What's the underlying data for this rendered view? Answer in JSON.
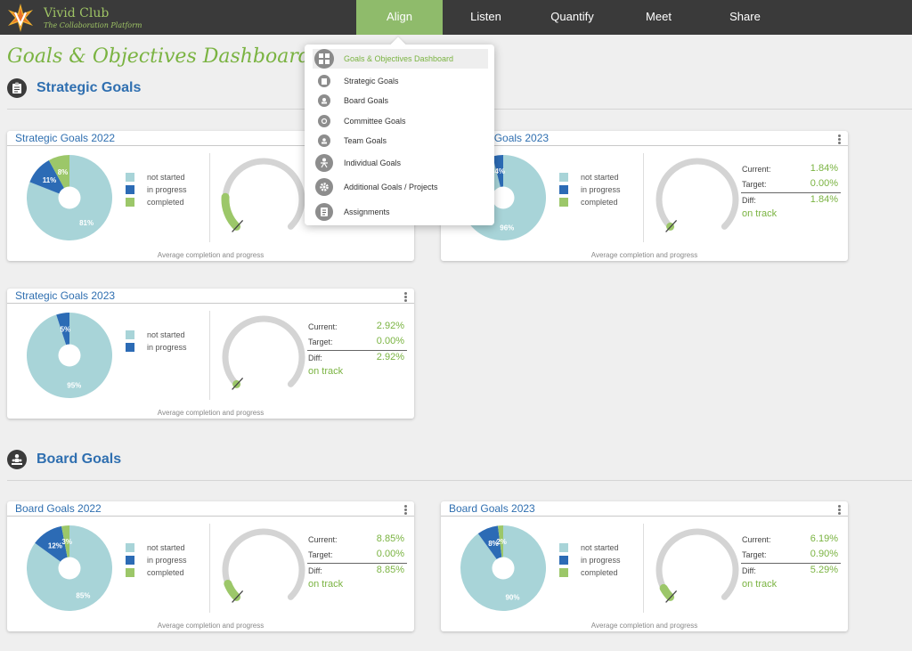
{
  "brand": {
    "name": "Vivid Club",
    "tagline": "The Collaboration Platform"
  },
  "nav": [
    "Align",
    "Listen",
    "Quantify",
    "Meet",
    "Share"
  ],
  "page_title": "Goals & Objectives Dashboard",
  "dropdown": [
    {
      "label": "Goals & Objectives Dashboard",
      "icon": "dashboard-icon",
      "active": true
    },
    {
      "label": "Strategic Goals",
      "icon": "strategic-goals-icon"
    },
    {
      "label": "Board Goals",
      "icon": "board-goals-icon"
    },
    {
      "label": "Committee Goals",
      "icon": "committee-goals-icon"
    },
    {
      "label": "Team Goals",
      "icon": "team-goals-icon"
    },
    {
      "label": "Individual Goals",
      "icon": "individual-goals-icon"
    },
    {
      "label": "Additional Goals / Projects",
      "icon": "gear-icon"
    },
    {
      "label": "Assignments",
      "icon": "assignments-icon"
    }
  ],
  "sections": {
    "strategic": {
      "title": "Strategic Goals"
    },
    "board": {
      "title": "Board Goals"
    }
  },
  "colors": {
    "not_started": "#a8d4d8",
    "in_progress": "#2c6bb5",
    "completed": "#9cc769",
    "accent_green": "#7ab341",
    "title_blue": "#2f6fb0"
  },
  "legend_labels": {
    "not_started": "not started",
    "in_progress": "in progress",
    "completed": "completed"
  },
  "caption": "Average completion and progress",
  "stat_labels": {
    "current": "Current:",
    "target": "Target:",
    "diff": "Diff:"
  },
  "cards": [
    {
      "id": "sg2022",
      "title": "Strategic Goals 2022",
      "slices": [
        {
          "key": "not_started",
          "value": 81,
          "label": "81%"
        },
        {
          "key": "in_progress",
          "value": 11,
          "label": "11%"
        },
        {
          "key": "completed",
          "value": 8,
          "label": "8%"
        }
      ],
      "gauge_progress": 0.18,
      "current": "",
      "target": "",
      "diff": "",
      "status": ""
    },
    {
      "id": "sg2023a",
      "title": "Strategic Goals 2023",
      "slices": [
        {
          "key": "not_started",
          "value": 96,
          "label": "96%"
        },
        {
          "key": "in_progress",
          "value": 4,
          "label": "4%"
        }
      ],
      "legend_keys": [
        "not_started",
        "in_progress",
        "completed"
      ],
      "gauge_progress": 0.0184,
      "current": "1.84%",
      "target": "0.00%",
      "diff": "1.84%",
      "status": "on track"
    },
    {
      "id": "sg2023b",
      "title": "Strategic Goals 2023",
      "slices": [
        {
          "key": "not_started",
          "value": 95,
          "label": "95%"
        },
        {
          "key": "in_progress",
          "value": 5,
          "label": "5%"
        }
      ],
      "gauge_progress": 0.0292,
      "current": "2.92%",
      "target": "0.00%",
      "diff": "2.92%",
      "status": "on track"
    },
    {
      "id": "bg2022",
      "title": "Board Goals 2022",
      "slices": [
        {
          "key": "not_started",
          "value": 85,
          "label": "85%"
        },
        {
          "key": "in_progress",
          "value": 12,
          "label": "12%"
        },
        {
          "key": "completed",
          "value": 3,
          "label": "3%"
        }
      ],
      "gauge_progress": 0.0885,
      "current": "8.85%",
      "target": "0.00%",
      "diff": "8.85%",
      "status": "on track"
    },
    {
      "id": "bg2023",
      "title": "Board Goals 2023",
      "slices": [
        {
          "key": "not_started",
          "value": 90,
          "label": "90%"
        },
        {
          "key": "in_progress",
          "value": 8,
          "label": "8%"
        },
        {
          "key": "completed",
          "value": 2,
          "label": "2%"
        }
      ],
      "gauge_progress": 0.0619,
      "current": "6.19%",
      "target": "0.90%",
      "diff": "5.29%",
      "status": "on track"
    }
  ]
}
